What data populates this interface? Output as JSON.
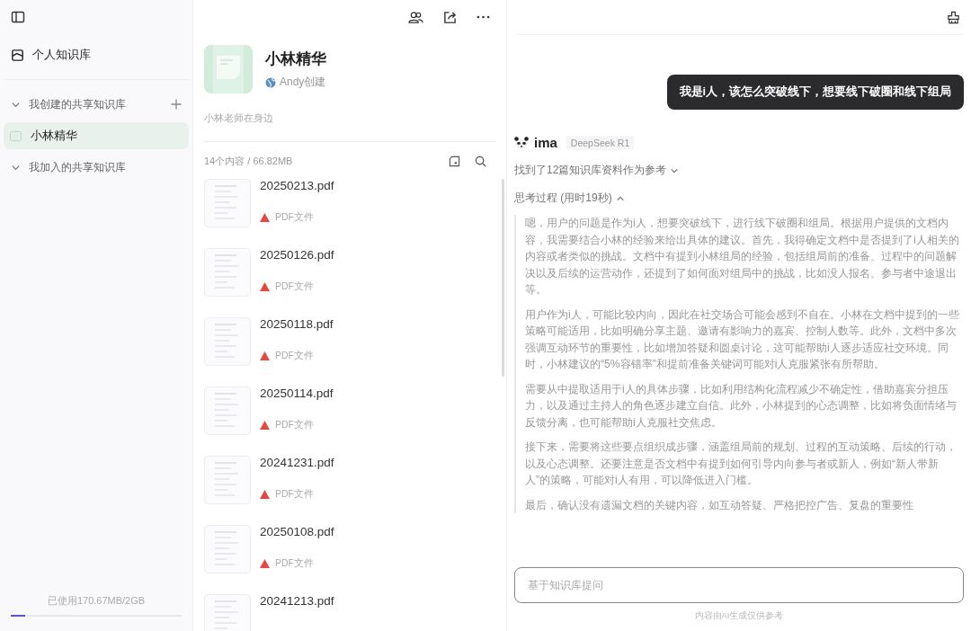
{
  "sidebar": {
    "personal": "个人知识库",
    "sections": [
      {
        "label": "我创建的共享知识库",
        "expanded": true,
        "addable": true,
        "items": [
          {
            "label": "小林精华",
            "selected": true
          }
        ]
      },
      {
        "label": "我加入的共享知识库",
        "expanded": true
      }
    ],
    "storage": {
      "text": "已使用170.67MB/2GB",
      "level": 0.085
    }
  },
  "knowledge_base": {
    "title": "小林精华",
    "creator": "Andy创建",
    "description": "小林老师在身边",
    "summary": "14个内容 / 66.82MB",
    "files": [
      {
        "name": "20250213.pdf",
        "type": "PDF文件"
      },
      {
        "name": "20250126.pdf",
        "type": "PDF文件"
      },
      {
        "name": "20250118.pdf",
        "type": "PDF文件"
      },
      {
        "name": "20250114.pdf",
        "type": "PDF文件"
      },
      {
        "name": "20241231.pdf",
        "type": "PDF文件"
      },
      {
        "name": "20250108.pdf",
        "type": "PDF文件"
      },
      {
        "name": "20241213.pdf"
      }
    ]
  },
  "chat": {
    "question": "我是i人，该怎么突破线下，想要线下破圈和线下组局",
    "bot": "ima",
    "model": "DeepSeek R1",
    "references": {
      "text": "找到了12篇知识库资料作为参考",
      "expanded": false
    },
    "thinking": {
      "title": "思考过程 (用时19秒)",
      "expanded": true,
      "paragraphs": [
        "嗯，用户的问题是作为i人，想要突破线下，进行线下破圈和组局。根据用户提供的文档内容，我需要结合小林的经验来给出具体的建议。首先，我得确定文档中是否提到了i人相关的内容或者类似的挑战。文档中有提到小林组局的经验，包括组局前的准备、过程中的问题解决以及后续的运营动作，还提到了如何面对组局中的挑战，比如没人报名、参与者中途退出等。",
        "用户作为i人，可能比较内向，因此在社交场合可能会感到不自在。小林在文档中提到的一些策略可能适用，比如明确分享主题、邀请有影响力的嘉宾、控制人数等。此外，文档中多次强调互动环节的重要性，比如增加答疑和圆桌讨论，这可能帮助i人逐步适应社交环境。同时，小林建议的“5%容错率”和提前准备关键词可能对i人克服紧张有所帮助。",
        "需要从中提取适用于i人的具体步骤，比如利用结构化流程减少不确定性，借助嘉宾分担压力，以及通过主持人的角色逐步建立自信。此外，小林提到的心态调整，比如将负面情绪与反馈分离，也可能帮助i人克服社交焦虑。",
        "接下来，需要将这些要点组织成步骤，涵盖组局前的规划、过程的互动策略、后续的行动，以及心态调整。还要注意是否文档中有提到如何引导内向参与者或新人，例如“新人带新人”的策略，可能对i人有用，可以降低进入门槛。",
        "最后，确认没有遗漏文档的关键内容，如互动答疑、严格把控广告、复盘的重要性"
      ]
    },
    "input": {
      "placeholder": "基于知识库提问"
    },
    "disclaimer": "内容由AI生成仅供参考"
  }
}
